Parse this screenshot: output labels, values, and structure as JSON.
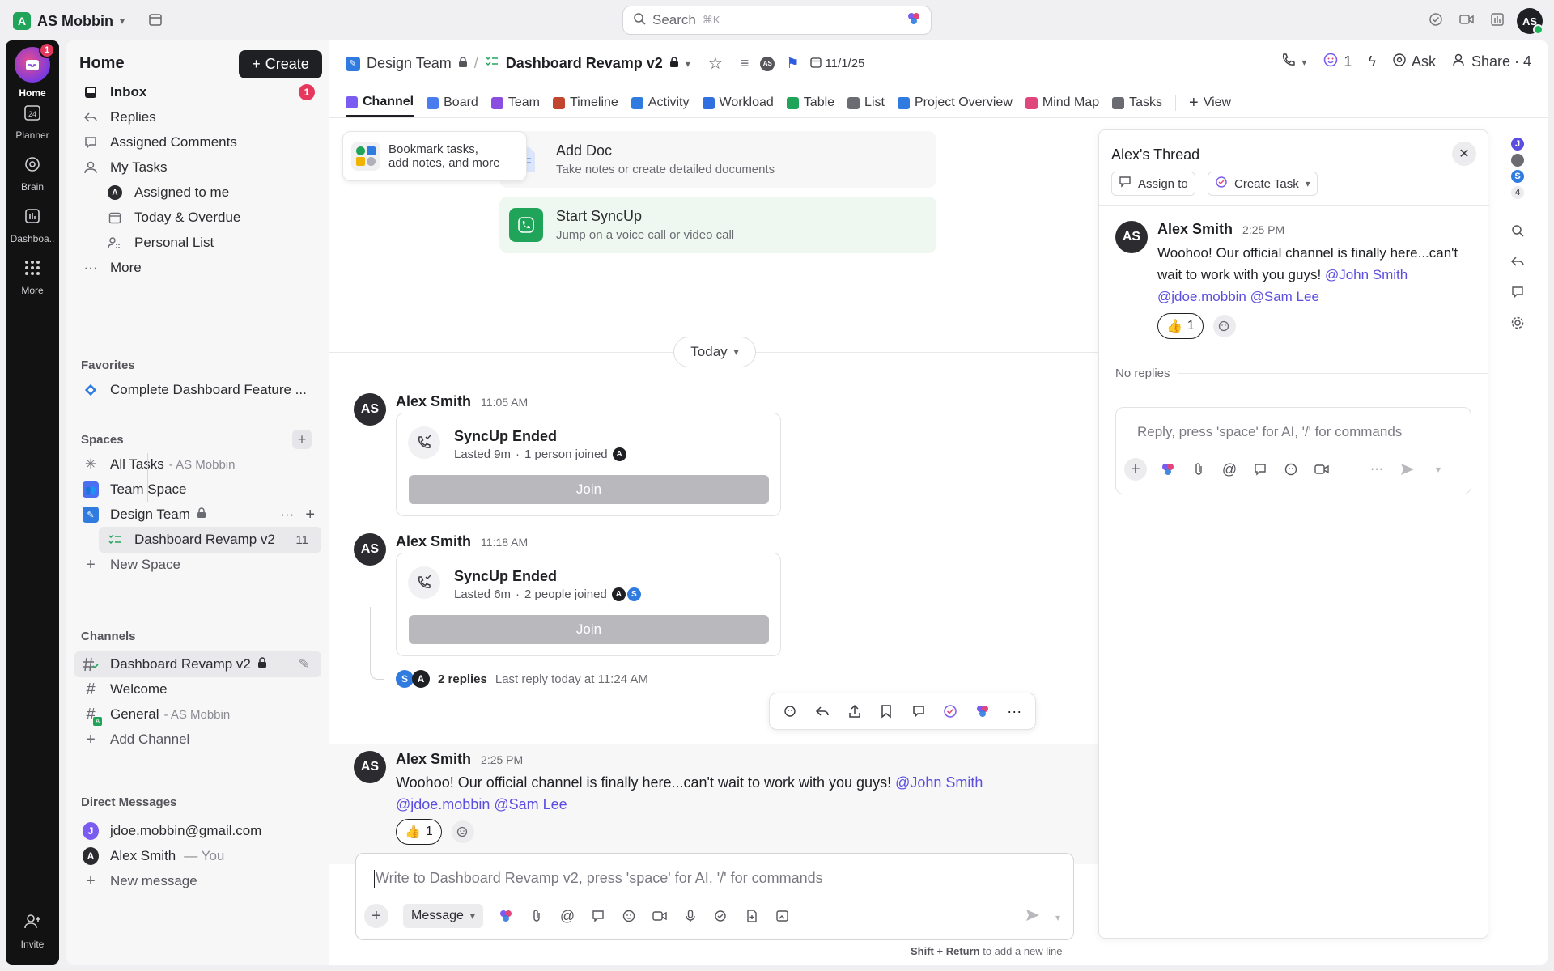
{
  "workspace": {
    "badge": "A",
    "name": "AS Mobbin"
  },
  "search": {
    "placeholder": "Search",
    "shortcut": "⌘K"
  },
  "user": {
    "initials": "AS"
  },
  "rail": {
    "home": {
      "label": "Home",
      "badge": "1"
    },
    "planner": {
      "label": "Planner",
      "day": "24"
    },
    "brain": {
      "label": "Brain"
    },
    "dashboards": {
      "label": "Dashboa.."
    },
    "more": {
      "label": "More"
    },
    "invite": {
      "label": "Invite"
    }
  },
  "sidebar": {
    "title": "Home",
    "create_label": "Create",
    "nav": {
      "inbox": {
        "label": "Inbox",
        "badge": "1"
      },
      "replies": "Replies",
      "assigned_comments": "Assigned Comments",
      "my_tasks": "My Tasks",
      "assigned_to_me": "Assigned to me",
      "assigned_to_me_avatar": "A",
      "today_overdue": "Today & Overdue",
      "personal_list": "Personal List",
      "more": "More"
    },
    "favorites": {
      "heading": "Favorites",
      "item": "Complete Dashboard Feature ..."
    },
    "spaces": {
      "heading": "Spaces",
      "all_tasks": "All Tasks",
      "all_tasks_suffix": "- AS Mobbin",
      "team_space": "Team Space",
      "design_team": "Design Team",
      "dashboard_revamp": "Dashboard Revamp v2",
      "dashboard_revamp_count": "11",
      "new_space": "New Space"
    },
    "channels": {
      "heading": "Channels",
      "dashboard_revamp": "Dashboard Revamp v2",
      "welcome": "Welcome",
      "general": "General",
      "general_suffix": "- AS Mobbin",
      "add_channel": "Add Channel"
    },
    "direct_messages": {
      "heading": "Direct Messages",
      "dm1": "jdoe.mobbin@gmail.com",
      "dm1_avatar": "J",
      "dm2": "Alex Smith",
      "dm2_suffix": "— You",
      "dm2_avatar": "A",
      "new_message": "New message"
    }
  },
  "header": {
    "breadcrumb_space": "Design Team",
    "breadcrumb_list": "Dashboard Revamp v2",
    "assignee_initials": "AS",
    "date": "11/1/25",
    "notif_count": "1",
    "ask_label": "Ask",
    "share_label": "Share · 4"
  },
  "tabs": [
    {
      "label": "Channel",
      "color": "#7b5cf0"
    },
    {
      "label": "Board",
      "color": "#4a7cf0"
    },
    {
      "label": "Team",
      "color": "#8a4de0"
    },
    {
      "label": "Timeline",
      "color": "#c2452f"
    },
    {
      "label": "Activity",
      "color": "#2f7be0"
    },
    {
      "label": "Workload",
      "color": "#2f6fe0"
    },
    {
      "label": "Table",
      "color": "#1fa45a"
    },
    {
      "label": "List",
      "color": "#6b6b72"
    },
    {
      "label": "Project Overview",
      "color": "#2f7be0"
    },
    {
      "label": "Mind Map",
      "color": "#e0457b"
    },
    {
      "label": "Tasks",
      "color": "#6b6b72"
    }
  ],
  "tabs_view_label": "View",
  "bookmark_hint": {
    "line1": "Bookmark tasks,",
    "line2": "add notes, and more"
  },
  "add_doc": {
    "title": "Add Doc",
    "subtitle": "Take notes or create detailed documents"
  },
  "start_syncup": {
    "title": "Start SyncUp",
    "subtitle": "Jump on a voice call or video call"
  },
  "today_label": "Today",
  "messages": [
    {
      "author": "Alex Smith",
      "initials": "AS",
      "time": "11:05 AM",
      "card_title": "SyncUp Ended",
      "lasted": "Lasted 9m",
      "joined": "1 person joined",
      "join_label": "Join"
    },
    {
      "author": "Alex Smith",
      "initials": "AS",
      "time": "11:18 AM",
      "card_title": "SyncUp Ended",
      "lasted": "Lasted 6m",
      "joined": "2 people joined",
      "join_label": "Join"
    }
  ],
  "participants": {
    "a": "A",
    "s": "S"
  },
  "replies_summary": {
    "count": "2 replies",
    "last": "Last reply today at 11:24 AM"
  },
  "post": {
    "author": "Alex Smith",
    "initials": "AS",
    "time": "2:25 PM",
    "text": "Woohoo! Our official channel is finally here...can't wait to work with you guys!",
    "mention1": "@John Smith",
    "mention2": "@jdoe.mobbin",
    "mention3": "@Sam Lee",
    "reaction_emoji": "👍",
    "reaction_count": "1"
  },
  "composer": {
    "placeholder": "Write to Dashboard Revamp v2, press 'space' for AI, '/' for commands",
    "mode": "Message",
    "hint_key": "Shift + Return",
    "hint_text": "to add a new line"
  },
  "thread": {
    "title": "Alex's Thread",
    "assign_to": "Assign to",
    "create_task": "Create Task",
    "author": "Alex Smith",
    "initials": "AS",
    "time": "2:25 PM",
    "text": "Woohoo! Our official channel is finally here...can't wait to work with you guys!",
    "mention1": "@John Smith",
    "mention2": "@jdoe.mobbin",
    "mention3": "@Sam Lee",
    "reaction_emoji": "👍",
    "reaction_count": "1",
    "no_replies": "No replies",
    "reply_placeholder": "Reply, press 'space' for AI, '/' for commands"
  },
  "right_strip": {
    "av1": "J",
    "av3": "S",
    "watchers": "4"
  }
}
